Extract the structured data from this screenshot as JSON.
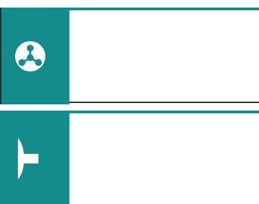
{
  "panels": [
    {
      "icon": "network-node-icon"
    },
    {
      "icon": "valve-outlet-icon"
    }
  ],
  "colors": {
    "accent": "#158c8c",
    "border": "#2b2b2b",
    "background": "#ffffff"
  }
}
